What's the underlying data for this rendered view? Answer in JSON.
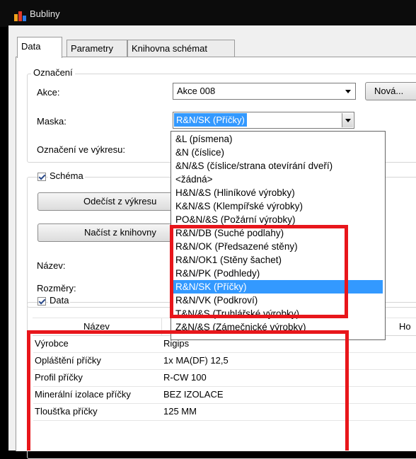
{
  "window": {
    "title": "Bubliny"
  },
  "tabs": [
    {
      "label": "Data"
    },
    {
      "label": "Parametry"
    },
    {
      "label": "Knihovna schémat"
    }
  ],
  "oznaceni": {
    "group_label": "Označení",
    "akce_label": "Akce:",
    "akce_value": "Akce 008",
    "nova_button": "Nová...",
    "maska_label": "Maska:",
    "maska_value": "R&N/SK (Příčky)",
    "oznaceni_label": "Označení ve výkresu:"
  },
  "schema": {
    "checkbox_label": "Schéma",
    "odecist_button": "Odečíst z výkresu",
    "nacist_button": "Načíst z knihovny",
    "nazev_label": "Název:",
    "rozmery_label": "Rozměry:"
  },
  "dropdown": {
    "options": [
      "&L (písmena)",
      "&N (číslice)",
      "&N/&S (číslice/strana otevírání dveří)",
      "<žádná>",
      "H&N/&S (Hliníkové výrobky)",
      "K&N/&S (Klempířské výrobky)",
      "PO&N/&S (Požární výrobky)",
      "R&N/DB (Suché podlahy)",
      "R&N/OK (Předsazené stěny)",
      "R&N/OK1 (Stěny šachet)",
      "R&N/PK (Podhledy)",
      "R&N/SK (Příčky)",
      "R&N/VK (Podkroví)",
      "T&N/&S (Truhlářské výrobky)",
      "Z&N/&S (Zámečnické výrobky)"
    ],
    "selected_index": 11
  },
  "data_section": {
    "checkbox_label": "Data",
    "columns": [
      "Název",
      "Ho"
    ],
    "rows": [
      [
        "Výrobce",
        "Rigips"
      ],
      [
        "Opláštění příčky",
        "1x MA(DF) 12,5"
      ],
      [
        "Profil příčky",
        "R-CW 100"
      ],
      [
        "Minerální izolace příčky",
        "BEZ IZOLACE"
      ],
      [
        "Tloušťka příčky",
        "125 MM"
      ]
    ]
  },
  "colors": {
    "highlight": "#e8161b",
    "selection": "#3399ff"
  }
}
